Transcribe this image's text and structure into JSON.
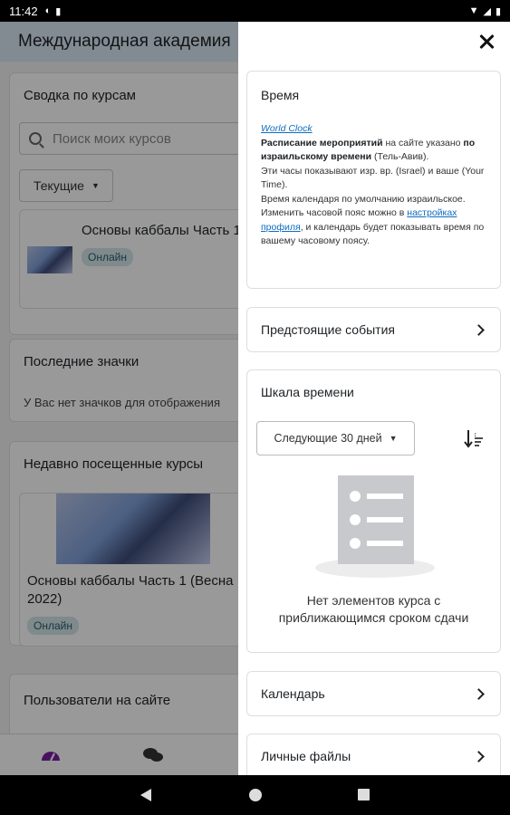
{
  "status_bar": {
    "time": "11:42"
  },
  "background": {
    "header_title": "Международная академия",
    "summary_title": "Сводка по курсам",
    "search_placeholder": "Поиск моих курсов",
    "filter_label": "Текущие",
    "course_name": "Основы каббалы Часть 1",
    "online_badge": "Онлайн",
    "badges_title": "Последние значки",
    "badges_empty": "У Вас нет значков для отображения",
    "recent_title": "Недавно посещенные курсы",
    "recent_course_line1": "Основы каббалы Часть 1 (Весна",
    "recent_course_line2": "2022)",
    "recent_badge": "Онлайн",
    "users_title": "Пользователи на сайте"
  },
  "drawer": {
    "time_block": {
      "title": "Время",
      "world_clock": "World Clock",
      "p1_bold": "Расписание мероприятий",
      "p1_rest": " на сайте указано ",
      "p1_bold2": "по израильскому времени",
      "p1_tail": " (Тель-Авив).",
      "p2": "Эти часы показывают изр. вр. (Israel) и ваше (Your Time).",
      "p3": "Время календаря по умолчанию израильское.",
      "p4_pre": "Изменить часовой пояс можно в ",
      "p4_link": "настройках профиля",
      "p4_post": ", и календарь будет показывать время по вашему часовому поясу."
    },
    "upcoming_events": "Предстоящие события",
    "timeline": {
      "title": "Шкала времени",
      "filter": "Следующие 30 дней",
      "empty_line1": "Нет элементов курса с",
      "empty_line2": "приближающимся сроком сдачи"
    },
    "calendar": "Календарь",
    "private_files": "Личные файлы"
  }
}
